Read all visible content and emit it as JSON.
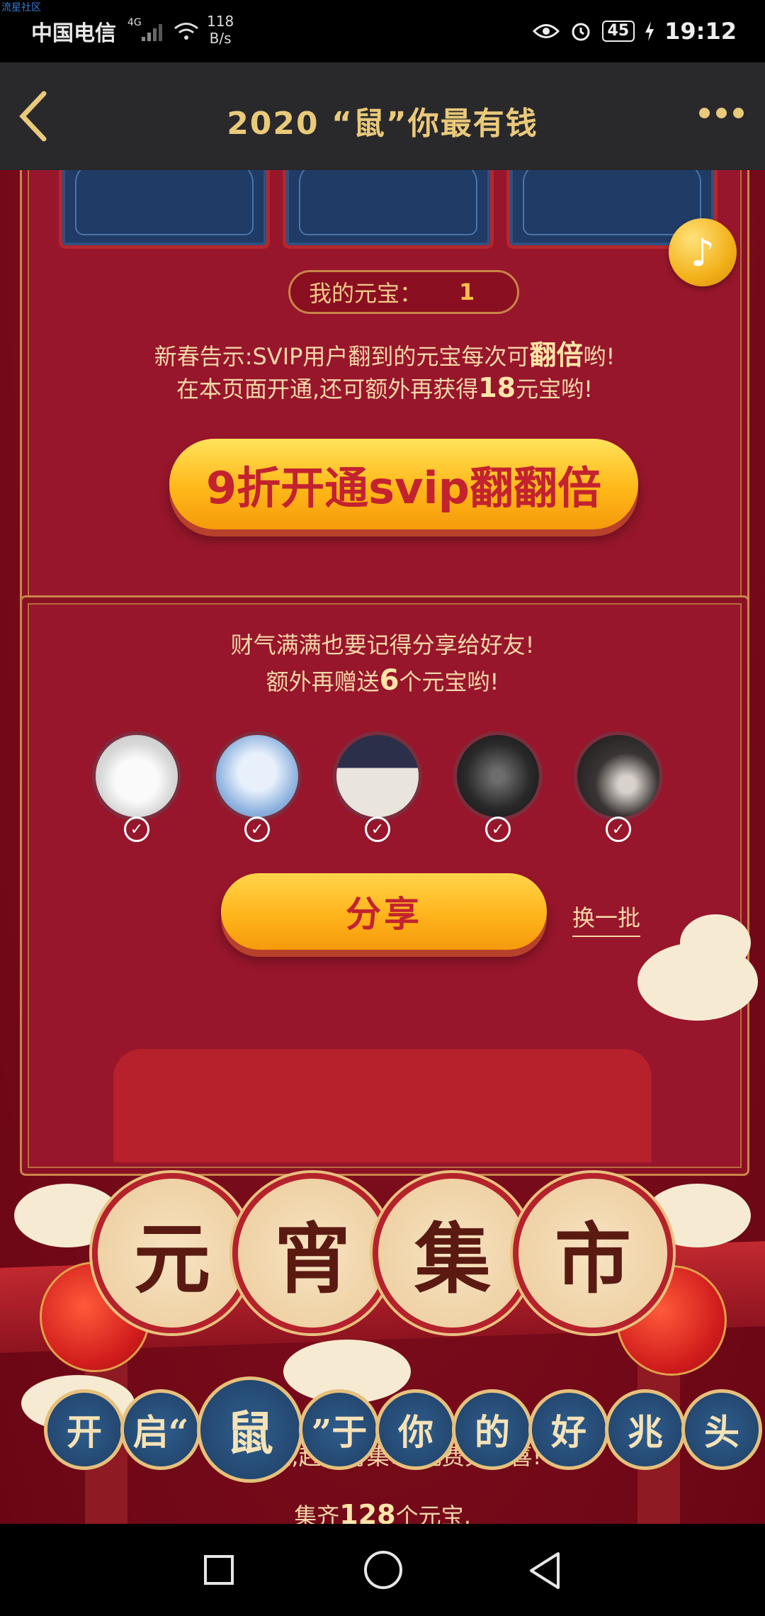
{
  "statusbar": {
    "watermark": "流星社区",
    "carrier": "中国电信",
    "network": "4G",
    "speed_value": "118",
    "speed_unit": "B/s",
    "battery": "45",
    "time": "19:12"
  },
  "titlebar": {
    "title": "2020 “鼠”你最有钱"
  },
  "panel1": {
    "yuanbao_label": "我的元宝：",
    "yuanbao_value": "1",
    "notice_line1_pre": "新春告示:SVIP用户翻到的元宝每次可",
    "notice_line1_em": "翻倍",
    "notice_line1_post": "哟!",
    "notice_line2_pre": "在本页面开通,还可额外再获得",
    "notice_line2_em": "18",
    "notice_line2_post": "元宝哟!",
    "svip_button": "9折开通svip翻翻倍"
  },
  "panel2": {
    "line1": "财气满满也要记得分享给好友!",
    "line2_pre": "额外再赠送",
    "line2_em": "6",
    "line2_post": "个元宝哟!",
    "share_button": "分享",
    "swap_link": "换一批",
    "friends": [
      "friend-1",
      "friend-2",
      "friend-3",
      "friend-4",
      "friend-5"
    ]
  },
  "market": {
    "chars": [
      "元",
      "宵",
      "集",
      "市"
    ],
    "subtitle": "集元宝,赶元宵集市,免费兑惊喜!",
    "slogan": [
      "开",
      "启“",
      "鼠",
      "”于",
      "你",
      "的",
      "好",
      "兆",
      "头"
    ],
    "bottom_pre": "集齐",
    "bottom_em": "128",
    "bottom_post": "个元宝,"
  },
  "icons": {
    "back": "chevron-left-icon",
    "more": "more-dots-icon",
    "music": "music-note-icon",
    "check": "check-circle-icon"
  }
}
